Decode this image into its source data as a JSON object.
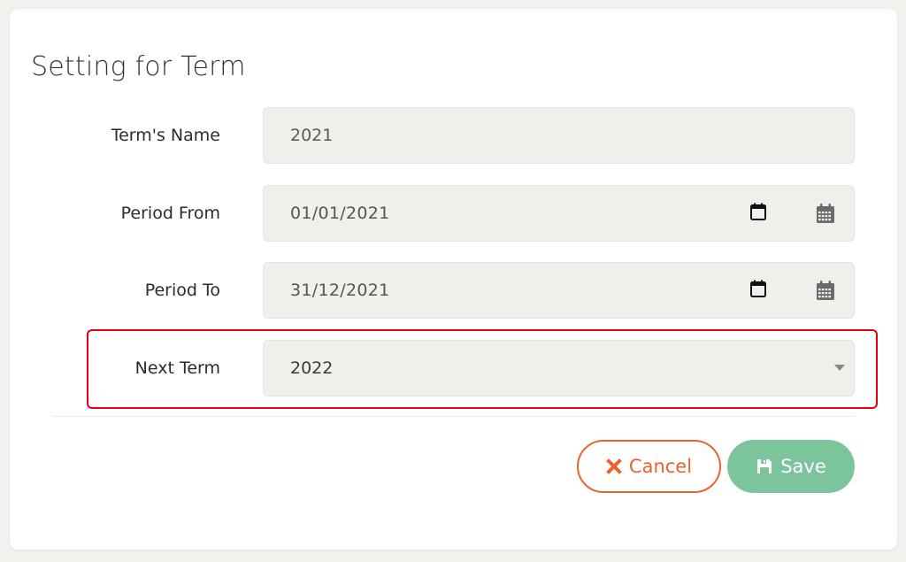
{
  "page": {
    "title": "Setting for Term"
  },
  "form": {
    "term_name": {
      "label": "Term's Name",
      "value": "2021"
    },
    "period_from": {
      "label": "Period From",
      "value": "01/01/2021"
    },
    "period_to": {
      "label": "Period To",
      "value": "31/12/2021"
    },
    "next_term": {
      "label": "Next Term",
      "value": "2022"
    }
  },
  "actions": {
    "cancel_label": "Cancel",
    "save_label": "Save"
  },
  "colors": {
    "background": "#f2f1ed",
    "field_bg": "#f0efeb",
    "cancel": "#e8642c",
    "save": "#7cc49c",
    "highlight": "#e60012"
  }
}
